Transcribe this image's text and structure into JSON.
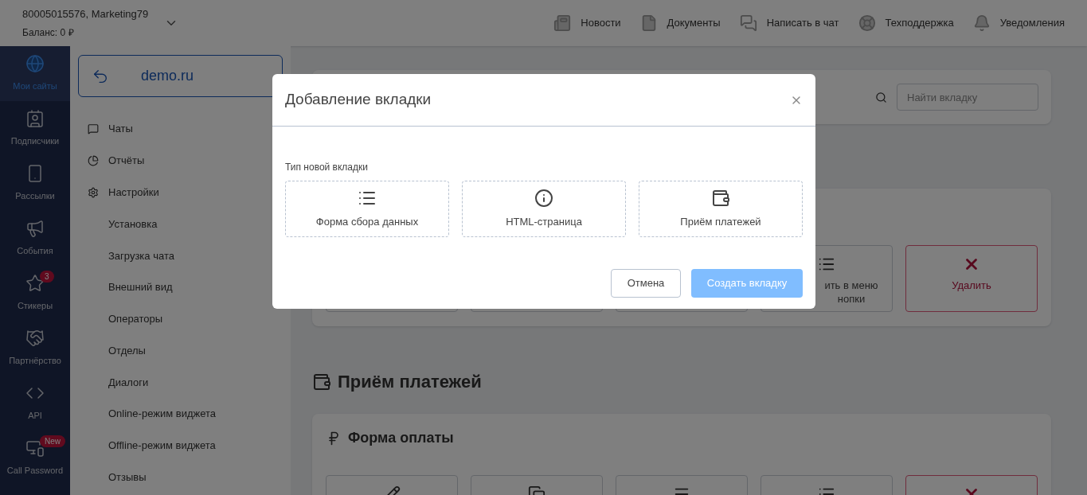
{
  "header": {
    "account": "80005015576, Marketing79",
    "balance": "Баланс: 0 ₽",
    "links": [
      {
        "kind": "news",
        "label": "Новости"
      },
      {
        "kind": "document",
        "label": "Документы"
      },
      {
        "kind": "chat",
        "label": "Написать в чат"
      },
      {
        "kind": "support",
        "label": "Техподдержка"
      },
      {
        "kind": "bell",
        "label": "Уведомления"
      }
    ]
  },
  "sidebar": {
    "items": [
      {
        "kind": "globe",
        "label": "Мои сайты",
        "selected": true
      },
      {
        "kind": "contact",
        "label": "Подписчики",
        "selected": false
      },
      {
        "kind": "phone",
        "label": "Рассылки",
        "selected": false
      },
      {
        "kind": "megaphone",
        "label": "События",
        "selected": false
      },
      {
        "kind": "star",
        "label": "Стикеры",
        "selected": false,
        "badge": "3"
      },
      {
        "kind": "handshake",
        "label": "Партнёрство",
        "selected": false
      },
      {
        "kind": "code",
        "label": "API",
        "selected": false
      },
      {
        "kind": "devices",
        "label": "Call Password",
        "selected": false,
        "badge": "New"
      }
    ]
  },
  "site_nav": {
    "site": "demo.ru",
    "items": [
      {
        "kind": "chats",
        "label": "Чаты"
      },
      {
        "kind": "reports",
        "label": "Отчёты"
      },
      {
        "kind": "settings",
        "label": "Настройки",
        "children": [
          {
            "label": "Установка"
          },
          {
            "label": "Загрузка чата"
          },
          {
            "label": "Внешний вид"
          },
          {
            "label": "Операторы"
          },
          {
            "label": "Отделы"
          },
          {
            "label": "Диалоги"
          },
          {
            "label": "Online-режим виджета"
          },
          {
            "label": "Offline-режим виджета"
          },
          {
            "label": "Отзывы"
          }
        ]
      }
    ]
  },
  "search": {
    "placeholder": "Найти вкладку"
  },
  "tabs_card": {
    "tiles": [
      {
        "kind": "blank"
      },
      {
        "kind": "blank"
      },
      {
        "kind": "blank"
      },
      {
        "kind": "list",
        "lines": [
          "ить в меню",
          "нопки"
        ]
      },
      {
        "kind": "delete",
        "lines": [
          "Удалить"
        ]
      }
    ]
  },
  "payments": {
    "heading": "Приём платежей",
    "card_title": "Форма оплаты",
    "tiles": [
      {
        "kind": "pencil"
      },
      {
        "kind": "copy"
      },
      {
        "kind": "menu"
      },
      {
        "kind": "list"
      },
      {
        "kind": "delete"
      }
    ]
  },
  "modal": {
    "title": "Добавление вкладки",
    "field_label": "Тип новой вкладки",
    "options": [
      {
        "kind": "list",
        "label": "Форма сбора данных"
      },
      {
        "kind": "info",
        "label": "HTML-страница"
      },
      {
        "kind": "wallet",
        "label": "Приём платежей"
      }
    ],
    "cancel": "Отмена",
    "create": {
      "label": "Создать вкладку",
      "disabled": true
    }
  }
}
